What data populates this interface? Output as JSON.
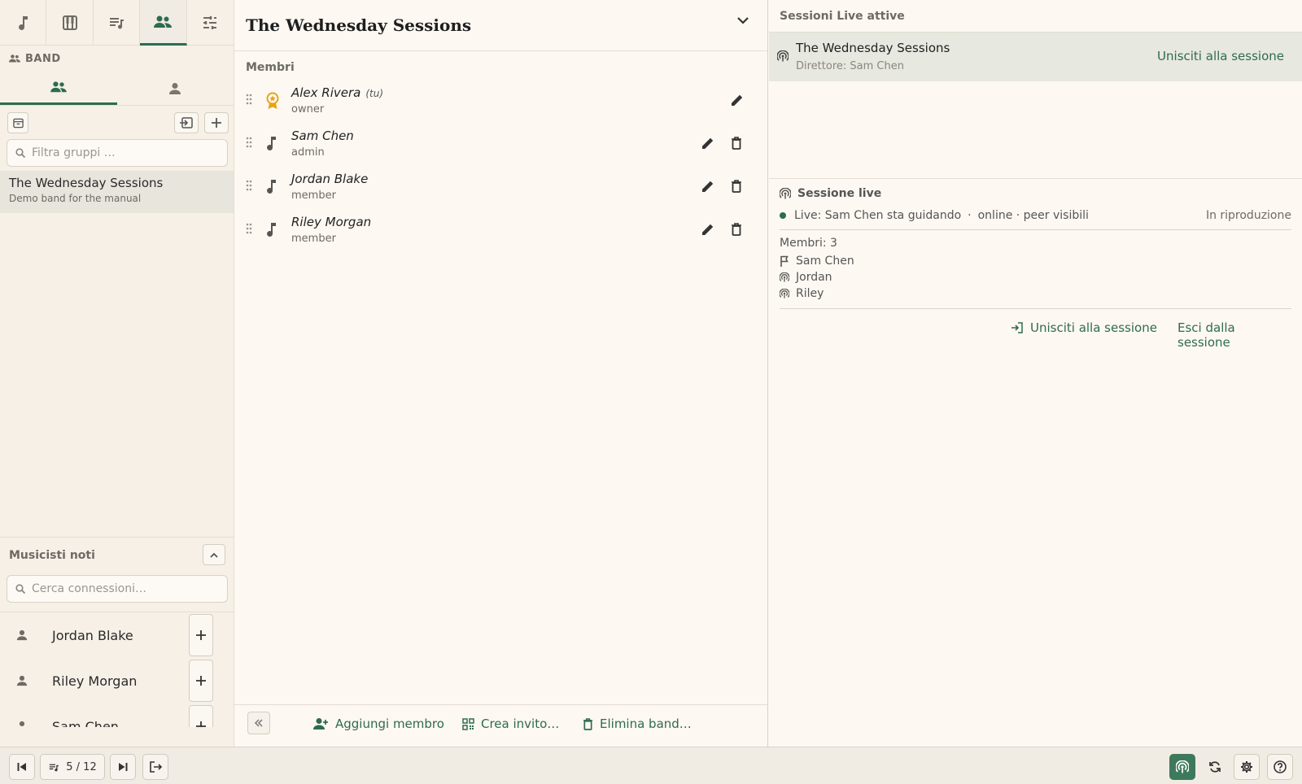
{
  "sidebar": {
    "top_tabs": [
      {
        "icon": "music-note-icon"
      },
      {
        "icon": "piano-icon"
      },
      {
        "icon": "playlist-icon"
      },
      {
        "icon": "band-icon",
        "active": true
      },
      {
        "icon": "sliders-icon"
      }
    ],
    "section_label": "BAND",
    "group_filter_placeholder": "Filtra gruppi …",
    "groups": [
      {
        "name": "The Wednesday Sessions",
        "description": "Demo band for the manual"
      }
    ],
    "musicians_title": "Musicisti noti",
    "connections_placeholder": "Cerca connessioni…",
    "connections": [
      {
        "name": "Jordan Blake"
      },
      {
        "name": "Riley Morgan"
      },
      {
        "name": "Sam Chen"
      }
    ]
  },
  "band": {
    "title": "The Wednesday Sessions",
    "members_label": "Membri",
    "you_tag": "(tu)",
    "members": [
      {
        "name": "Alex Rivera",
        "role": "owner"
      },
      {
        "name": "Sam Chen",
        "role": "admin"
      },
      {
        "name": "Jordan Blake",
        "role": "member"
      },
      {
        "name": "Riley Morgan",
        "role": "member"
      }
    ],
    "actions": {
      "add_member": "Aggiungi membro",
      "create_invite": "Crea invito…",
      "delete_band": "Elimina band…"
    }
  },
  "live": {
    "header": "Sessioni Live attive",
    "session": {
      "name": "The Wednesday Sessions",
      "director": "Direttore: Sam Chen",
      "join": "Unisciti alla sessione"
    },
    "panel_title": "Sessione live",
    "status_text": "Live: Sam Chen sta guidando",
    "status_sep": "·",
    "status_extra": "online · peer visibili",
    "state": "In riproduzione",
    "members_count": "Membri: 3",
    "members": [
      {
        "name": "Sam Chen",
        "icon": "flag-icon"
      },
      {
        "name": "Jordan",
        "icon": "broadcast-icon"
      },
      {
        "name": "Riley",
        "icon": "broadcast-icon"
      }
    ],
    "join_label": "Unisciti alla sessione",
    "leave_label": "Esci dalla sessione"
  },
  "bottom": {
    "page_counter": "5 / 12"
  },
  "colors": {
    "accent": "#2e6b4f",
    "owner_badge": "#e8a317",
    "selected_row": "#e7e5dc"
  }
}
